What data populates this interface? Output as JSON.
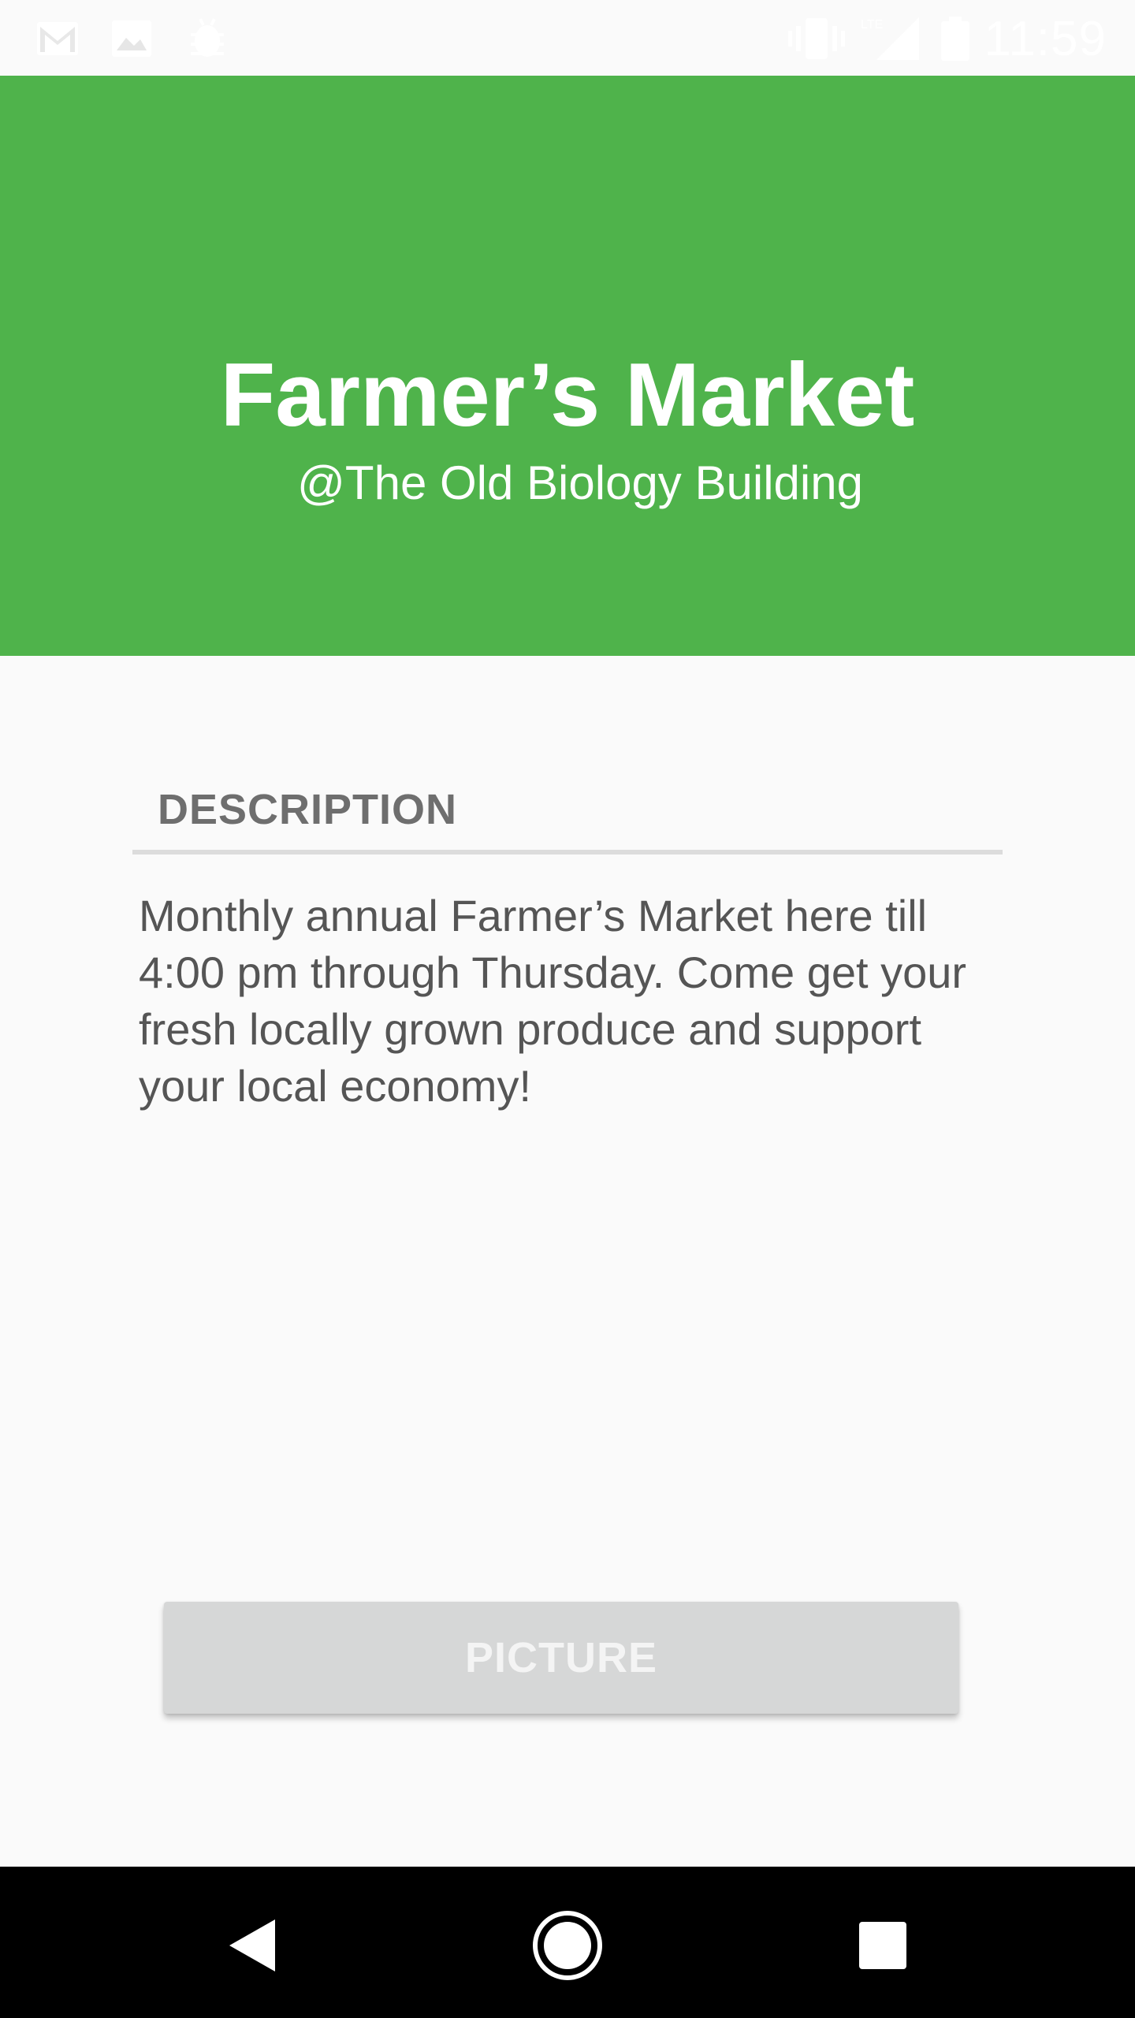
{
  "status_bar": {
    "time": "11:59",
    "left_icons": [
      "gmail-icon",
      "image-icon",
      "android-debug-icon"
    ],
    "right_icons": [
      "vibrate-icon",
      "lte-signal-icon",
      "battery-icon"
    ]
  },
  "header": {
    "title": "Farmer’s Market",
    "subtitle": "@The Old Biology Building",
    "background_color": "#4fb34b"
  },
  "description_section": {
    "label": "DESCRIPTION",
    "text": "Monthly annual Farmer’s Market here till 4:00 pm through Thursday. Come get your fresh locally grown produce and support your local economy!"
  },
  "picture_button": {
    "label": "PICTURE"
  },
  "nav_bar": {
    "icons": [
      "back-icon",
      "home-icon",
      "recents-icon"
    ]
  }
}
